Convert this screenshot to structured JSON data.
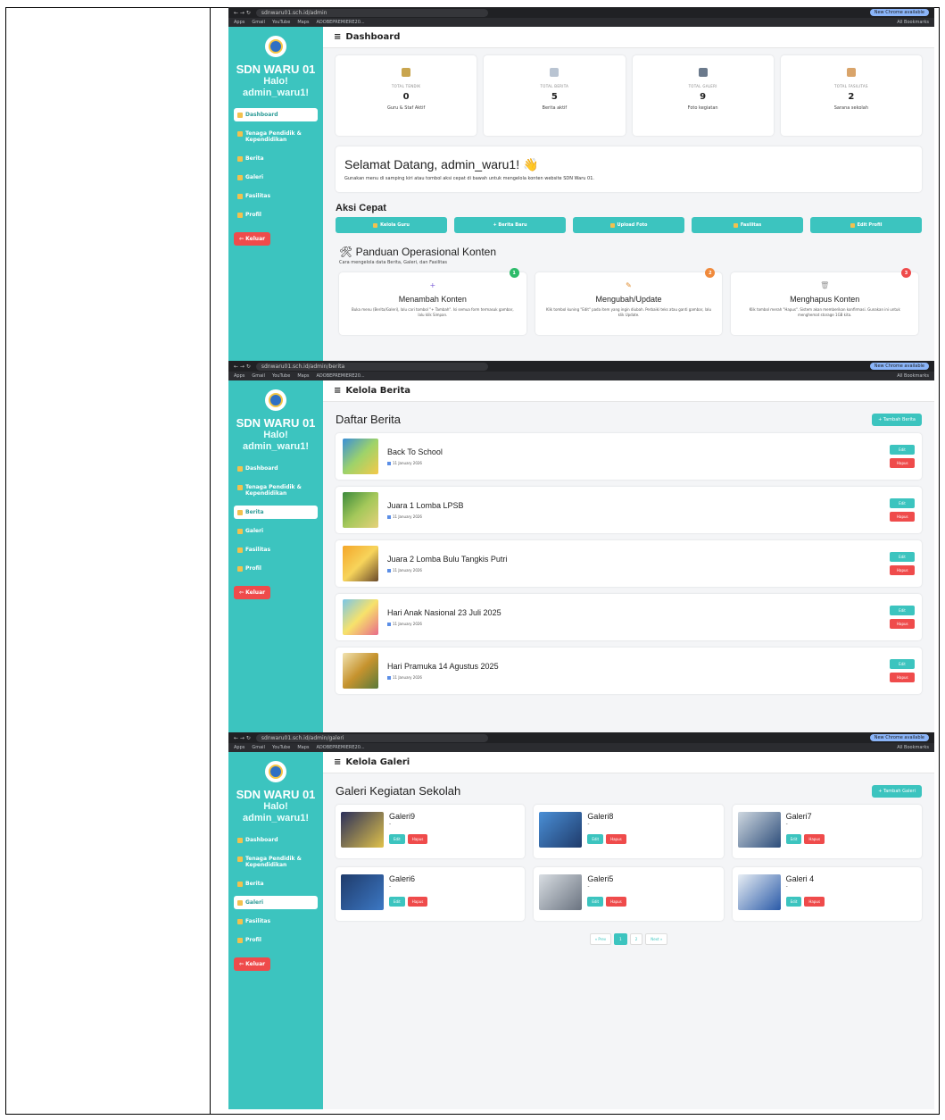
{
  "browser": {
    "url_dashboard": "sdnwaru01.sch.id/admin",
    "url_berita": "sdnwaru01.sch.id/admin/berita",
    "url_galeri": "sdnwaru01.sch.id/admin/galeri",
    "update": "New Chrome available",
    "bookmarks": [
      "Apps",
      "Gmail",
      "YouTube",
      "Maps",
      "ADOBEPREMIERE20..."
    ],
    "all_bookmarks": "All Bookmarks"
  },
  "sidebar": {
    "school": "SDN WARU 01",
    "greeting_line1": "Halo!",
    "greeting_line2": "admin_waru1!",
    "items": [
      "Dashboard",
      "Tenaga Pendidik & Kependidikan",
      "Berita",
      "Galeri",
      "Fasilitas",
      "Profil"
    ],
    "logout": "Keluar"
  },
  "dashboard": {
    "title": "Dashboard",
    "stats": [
      {
        "label": "TOTAL TENDIK",
        "value": "0",
        "desc": "Guru & Staf Aktif"
      },
      {
        "label": "TOTAL BERITA",
        "value": "5",
        "desc": "Berita aktif"
      },
      {
        "label": "TOTAL GALERI",
        "value": "9",
        "desc": "Foto kegiatan"
      },
      {
        "label": "TOTAL FASILITAS",
        "value": "2",
        "desc": "Sarana sekolah"
      }
    ],
    "welcome_title": "Selamat Datang, admin_waru1! 👋",
    "welcome_text": "Gunakan menu di samping kiri atau tombol aksi cepat di bawah untuk mengelola konten website SDN Waru 01.",
    "quick_title": "Aksi Cepat",
    "quick": [
      "Kelola Guru",
      "+ Berita Baru",
      "Upload Foto",
      "Fasilitas",
      "Edit Profil"
    ],
    "guide_title": "🛠 Panduan Operasional Konten",
    "guide_sub": "Cara mengelola data Berita, Galeri, dan Fasilitas",
    "guides": [
      {
        "num": "1",
        "icon": "+",
        "title": "Menambah Konten",
        "text": "Buka menu (Berita/Galeri), lalu cari tombol \"+ Tambah\". Isi semua form termasuk gambar, lalu klik Simpan."
      },
      {
        "num": "2",
        "icon": "✎",
        "title": "Mengubah/Update",
        "text": "Klik tombol kuning \"Edit\" pada item yang ingin diubah. Perbaiki teks atau ganti gambar, lalu klik Update."
      },
      {
        "num": "3",
        "icon": "🗑",
        "title": "Menghapus Konten",
        "text": "Klik tombol merah \"Hapus\". Sistem akan memberikan konfirmasi. Gunakan ini untuk menghemat storage 1GB kita."
      }
    ]
  },
  "berita": {
    "title": "Kelola Berita",
    "heading": "Daftar Berita",
    "add": "+ Tambah Berita",
    "edit": "Edit",
    "delete": "Hapus",
    "items": [
      {
        "title": "Back To School",
        "date": "11 January 2026"
      },
      {
        "title": "Juara 1 Lomba LPSB",
        "date": "11 January 2026"
      },
      {
        "title": "Juara 2 Lomba Bulu Tangkis Putri",
        "date": "11 January 2026"
      },
      {
        "title": "Hari Anak Nasional 23 Juli 2025",
        "date": "11 January 2026"
      },
      {
        "title": "Hari Pramuka 14 Agustus 2025",
        "date": "11 January 2026"
      }
    ]
  },
  "galeri": {
    "title": "Kelola Galeri",
    "heading": "Galeri Kegiatan Sekolah",
    "add": "+ Tambah Galeri",
    "edit": "Edit",
    "delete": "Hapus",
    "items": [
      {
        "title": "Galeri9",
        "desc": "-"
      },
      {
        "title": "Galeri8",
        "desc": "-"
      },
      {
        "title": "Galeri7",
        "desc": "-"
      },
      {
        "title": "Galeri6",
        "desc": "-"
      },
      {
        "title": "Galeri5",
        "desc": "-"
      },
      {
        "title": "Galeri 4",
        "desc": "-"
      }
    ],
    "pager": [
      "« Prev",
      "1",
      "2",
      "Next »"
    ]
  },
  "colors": {
    "accent": "#3cc4bf",
    "danger": "#ef4b4b"
  }
}
